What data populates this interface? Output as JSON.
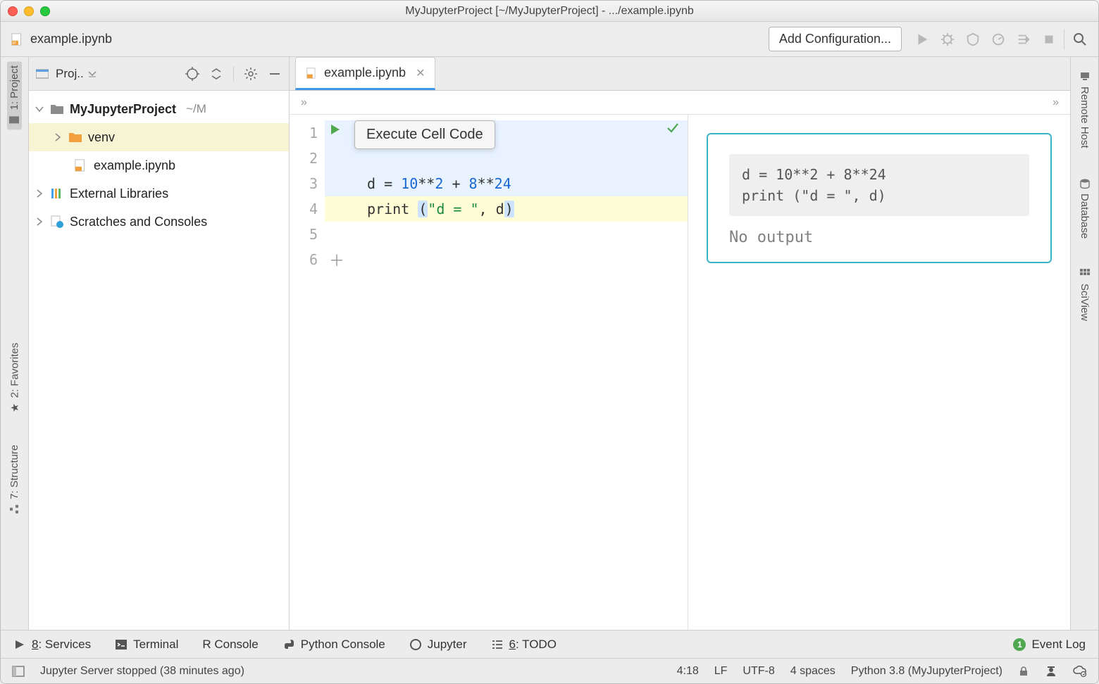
{
  "titlebar": {
    "title": "MyJupyterProject [~/MyJupyterProject] - .../example.ipynb"
  },
  "topbar": {
    "tab_label": "example.ipynb",
    "add_configuration": "Add Configuration..."
  },
  "leftstrip": {
    "project": "1: Project",
    "favorites": "2: Favorites",
    "structure": "7: Structure"
  },
  "rightstrip": {
    "remote_host": "Remote Host",
    "database": "Database",
    "sciview": "SciView"
  },
  "projectpane": {
    "button": "Proj..",
    "tree": {
      "root": {
        "name": "MyJupyterProject",
        "path": "~/M"
      },
      "venv": "venv",
      "file": "example.ipynb",
      "external": "External Libraries",
      "scratches": "Scratches and Consoles"
    }
  },
  "editor": {
    "tab": "example.ipynb",
    "breadcrumb_left": "»",
    "breadcrumb_right": "»",
    "tooltip": "Execute Cell Code",
    "gutter_lines": [
      "1",
      "2",
      "3",
      "4",
      "5",
      "6"
    ],
    "code": {
      "line3_pre": "d = ",
      "line3_n1": "10",
      "line3_op1": "**",
      "line3_n2": "2",
      "line3_plus": " + ",
      "line3_n3": "8",
      "line3_op2": "**",
      "line3_n4": "24",
      "line4_pre": "print ",
      "line4_open": "(",
      "line4_str": "\"d = \"",
      "line4_comma": ", d",
      "line4_close": ")"
    }
  },
  "preview": {
    "source_line1": "d = 10**2 + 8**24",
    "source_line2": "print (\"d = \", d)",
    "no_output": "No output"
  },
  "bottombar": {
    "services": "8: Services",
    "terminal": "Terminal",
    "r_console": "R Console",
    "py_console": "Python Console",
    "jupyter": "Jupyter",
    "todo": "6: TODO",
    "event_log": "Event Log",
    "event_badge": "1"
  },
  "statusbar": {
    "message": "Jupyter Server stopped (38 minutes ago)",
    "pos": "4:18",
    "lf": "LF",
    "enc": "UTF-8",
    "indent": "4 spaces",
    "interpreter": "Python 3.8 (MyJupyterProject)"
  }
}
